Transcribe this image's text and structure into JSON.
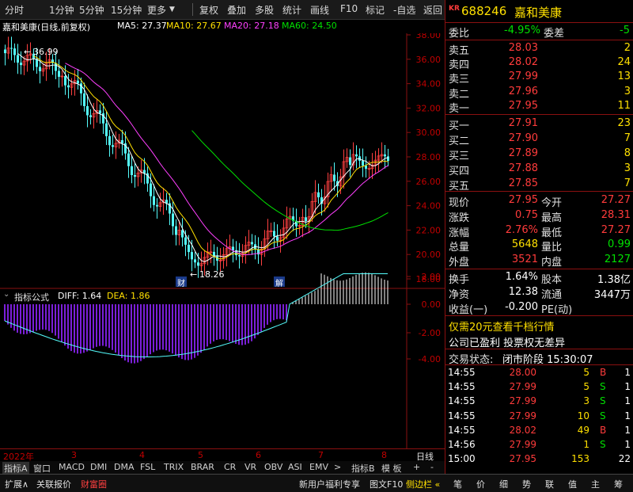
{
  "toolbar": {
    "left_items": [
      "分时",
      "1分钟",
      "5分钟",
      "15分钟",
      "更多"
    ],
    "right_items": [
      "复权",
      "叠加",
      "多股",
      "统计",
      "画线",
      "F10",
      "标记",
      "-自选",
      "返回"
    ]
  },
  "chart_header": {
    "title": "嘉和美康(日线,前复权)",
    "ma5": "MA5: 27.37",
    "ma10": "MA10: 27.67",
    "ma20": "MA20: 27.18",
    "ma60": "MA60: 24.50"
  },
  "price_axis": [
    "38.00",
    "36.00",
    "34.00",
    "32.00",
    "30.00",
    "28.00",
    "26.00",
    "24.00",
    "22.00",
    "20.00",
    "18.00"
  ],
  "annotations": {
    "high": "36.99",
    "low": "18.26",
    "marker_cai": "财",
    "marker_jie": "解"
  },
  "indicator_header": {
    "name": "指标公式",
    "diff": "DIFF: 1.64",
    "dea": "DEA: 1.86"
  },
  "macd_axis": [
    "2.00",
    "0.00",
    "-2.00",
    "-4.00"
  ],
  "date_axis": {
    "year": "2022年",
    "months": [
      "3",
      "4",
      "5",
      "6",
      "7",
      "8"
    ],
    "corner": "日线"
  },
  "indicator_tabs": [
    "指标A",
    "窗口",
    "MACD",
    "DMI",
    "DMA",
    "FSL",
    "TRIX",
    "BRAR",
    "CR",
    "VR",
    "OBV",
    "ASI",
    "EMV",
    ">",
    "指标B",
    "模 板",
    "+",
    "-"
  ],
  "bottom_bar": {
    "left": [
      "扩展∧",
      "关联报价",
      "财富圈"
    ],
    "mid": [
      "新用户福利专享",
      "图文F10",
      "侧边栏 «"
    ],
    "right": [
      "笔",
      "价",
      "细",
      "势",
      "联",
      "值",
      "主",
      "筹"
    ]
  },
  "stock": {
    "code": "688246",
    "name": "嘉和美康",
    "badge": "KR"
  },
  "weibi": {
    "label": "委比",
    "value": "-4.95%",
    "label2": "委差",
    "value2": "-5"
  },
  "asks": [
    {
      "label": "卖五",
      "price": "28.03",
      "vol": "2"
    },
    {
      "label": "卖四",
      "price": "28.02",
      "vol": "24"
    },
    {
      "label": "卖三",
      "price": "27.99",
      "vol": "13"
    },
    {
      "label": "卖二",
      "price": "27.96",
      "vol": "3"
    },
    {
      "label": "卖一",
      "price": "27.95",
      "vol": "11"
    }
  ],
  "bids": [
    {
      "label": "买一",
      "price": "27.91",
      "vol": "23"
    },
    {
      "label": "买二",
      "price": "27.90",
      "vol": "7"
    },
    {
      "label": "买三",
      "price": "27.89",
      "vol": "8"
    },
    {
      "label": "买四",
      "price": "27.88",
      "vol": "3"
    },
    {
      "label": "买五",
      "price": "27.85",
      "vol": "7"
    }
  ],
  "quote": [
    {
      "l1": "现价",
      "v1": "27.95",
      "c1": "red",
      "l2": "今开",
      "v2": "27.27",
      "c2": "red"
    },
    {
      "l1": "涨跌",
      "v1": "0.75",
      "c1": "red",
      "l2": "最高",
      "v2": "28.31",
      "c2": "red"
    },
    {
      "l1": "涨幅",
      "v1": "2.76%",
      "c1": "red",
      "l2": "最低",
      "v2": "27.27",
      "c2": "red"
    },
    {
      "l1": "总量",
      "v1": "5648",
      "c1": "yel",
      "l2": "量比",
      "v2": "0.99",
      "c2": "grn"
    },
    {
      "l1": "外盘",
      "v1": "3521",
      "c1": "red",
      "l2": "内盘",
      "v2": "2127",
      "c2": "grn"
    }
  ],
  "stats": [
    {
      "l1": "换手",
      "v1": "1.64%",
      "l2": "股本",
      "v2": "1.38亿"
    },
    {
      "l1": "净资",
      "v1": "12.38",
      "l2": "流通",
      "v2": "3447万"
    },
    {
      "l1": "收益(一)",
      "v1": "-0.200",
      "l2": "PE(动)",
      "v2": ""
    }
  ],
  "promo": "仅需20元查看千档行情",
  "notice": "公司已盈利 投票权无差异",
  "trade_status": {
    "label": "交易状态:",
    "value": "闭市阶段 15:30:07"
  },
  "ticks": [
    {
      "time": "14:55",
      "price": "28.00",
      "vol": "5",
      "side": "B"
    },
    {
      "time": "14:55",
      "price": "27.99",
      "vol": "5",
      "side": "S"
    },
    {
      "time": "14:55",
      "price": "27.99",
      "vol": "3",
      "side": "S"
    },
    {
      "time": "14:55",
      "price": "27.99",
      "vol": "10",
      "side": "S"
    },
    {
      "time": "14:55",
      "price": "28.02",
      "vol": "49",
      "side": "B"
    },
    {
      "time": "14:56",
      "price": "27.99",
      "vol": "1",
      "side": "S"
    },
    {
      "time": "15:00",
      "price": "27.95",
      "vol": "153",
      "side": "",
      "count": "22"
    }
  ],
  "tick_counts": [
    "1",
    "1",
    "1",
    "1",
    "1",
    "1"
  ]
}
